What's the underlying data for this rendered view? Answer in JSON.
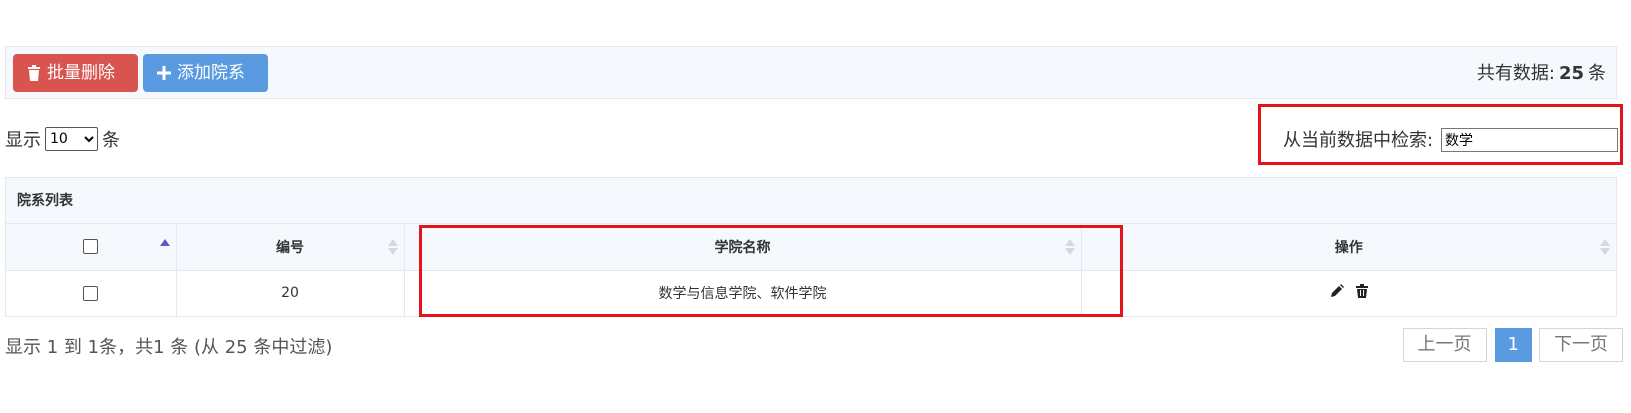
{
  "toolbar": {
    "batch_delete_label": "批量删除",
    "add_label": "添加院系",
    "total_prefix": "共有数据:",
    "total_count": "25",
    "total_suffix": "条",
    "colors": {
      "danger": "#d9534f",
      "primary": "#5a9ae0"
    }
  },
  "length_menu": {
    "prefix": "显示",
    "selected": "10",
    "suffix": "条"
  },
  "search": {
    "label": "从当前数据中检索:",
    "value": "数学"
  },
  "table": {
    "title": "院系列表",
    "columns": [
      "",
      "编号",
      "学院名称",
      "操作"
    ],
    "rows": [
      {
        "id": "20",
        "name": "数学与信息学院、软件学院",
        "actions": [
          "edit-icon",
          "trash-icon"
        ]
      }
    ]
  },
  "footer": {
    "info": "显示 1 到 1条，共1 条 (从 25 条中过滤)",
    "prev_label": "上一页",
    "current_page": "1",
    "next_label": "下一页"
  },
  "highlight_color": "#e3141b"
}
